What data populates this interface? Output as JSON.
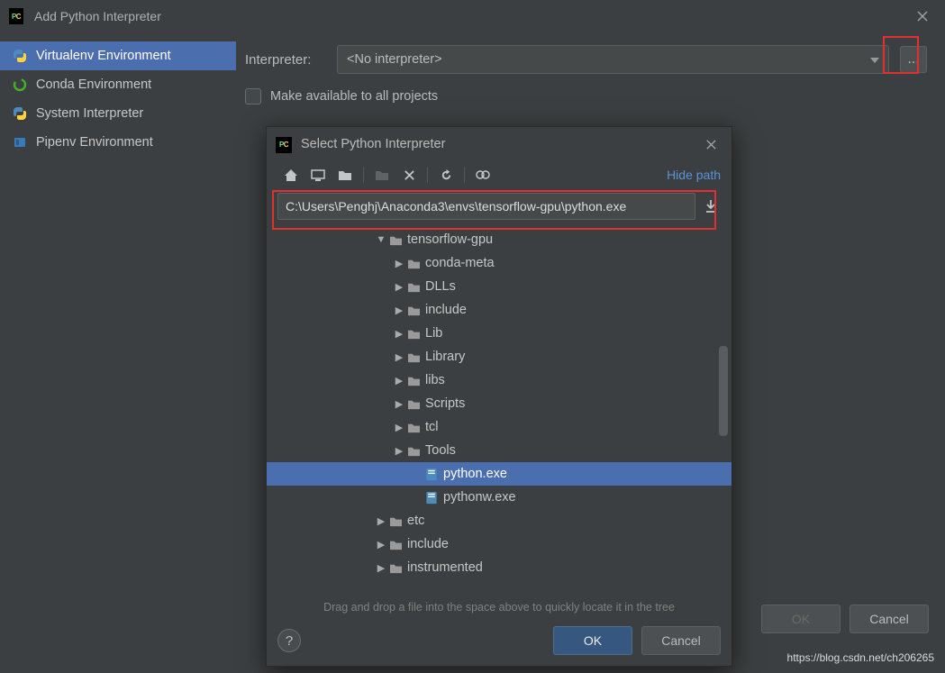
{
  "main": {
    "title": "Add Python Interpreter",
    "sidebar": {
      "items": [
        {
          "label": "Virtualenv Environment",
          "selected": true,
          "icon": "python-blue"
        },
        {
          "label": "Conda Environment",
          "selected": false,
          "icon": "conda-ring"
        },
        {
          "label": "System Interpreter",
          "selected": false,
          "icon": "python"
        },
        {
          "label": "Pipenv Environment",
          "selected": false,
          "icon": "pipenv"
        }
      ]
    },
    "interpreter_label": "Interpreter:",
    "interpreter_value": "<No interpreter>",
    "checkbox_label": "Make available to all projects",
    "ok_label": "OK",
    "cancel_label": "Cancel",
    "browse_label": "..."
  },
  "popup": {
    "title": "Select Python Interpreter",
    "hide_path": "Hide path",
    "path": "C:\\Users\\Penghj\\Anaconda3\\envs\\tensorflow-gpu\\python.exe",
    "hint": "Drag and drop a file into the space above to quickly locate it in the tree",
    "ok_label": "OK",
    "cancel_label": "Cancel",
    "tree": [
      {
        "indent": 120,
        "arrow": "down",
        "type": "folder",
        "label": "tensorflow-gpu",
        "selected": false
      },
      {
        "indent": 140,
        "arrow": "right",
        "type": "folder",
        "label": "conda-meta",
        "selected": false
      },
      {
        "indent": 140,
        "arrow": "right",
        "type": "folder",
        "label": "DLLs",
        "selected": false
      },
      {
        "indent": 140,
        "arrow": "right",
        "type": "folder",
        "label": "include",
        "selected": false
      },
      {
        "indent": 140,
        "arrow": "right",
        "type": "folder",
        "label": "Lib",
        "selected": false
      },
      {
        "indent": 140,
        "arrow": "right",
        "type": "folder",
        "label": "Library",
        "selected": false
      },
      {
        "indent": 140,
        "arrow": "right",
        "type": "folder",
        "label": "libs",
        "selected": false
      },
      {
        "indent": 140,
        "arrow": "right",
        "type": "folder",
        "label": "Scripts",
        "selected": false
      },
      {
        "indent": 140,
        "arrow": "right",
        "type": "folder",
        "label": "tcl",
        "selected": false
      },
      {
        "indent": 140,
        "arrow": "right",
        "type": "folder",
        "label": "Tools",
        "selected": false
      },
      {
        "indent": 160,
        "arrow": "",
        "type": "pyfile",
        "label": "python.exe",
        "selected": true
      },
      {
        "indent": 160,
        "arrow": "",
        "type": "pyfile",
        "label": "pythonw.exe",
        "selected": false
      },
      {
        "indent": 120,
        "arrow": "right",
        "type": "folder",
        "label": "etc",
        "selected": false
      },
      {
        "indent": 120,
        "arrow": "right",
        "type": "folder",
        "label": "include",
        "selected": false
      },
      {
        "indent": 120,
        "arrow": "right",
        "type": "folder",
        "label": "instrumented",
        "selected": false
      }
    ]
  },
  "watermark": "https://blog.csdn.net/ch206265"
}
